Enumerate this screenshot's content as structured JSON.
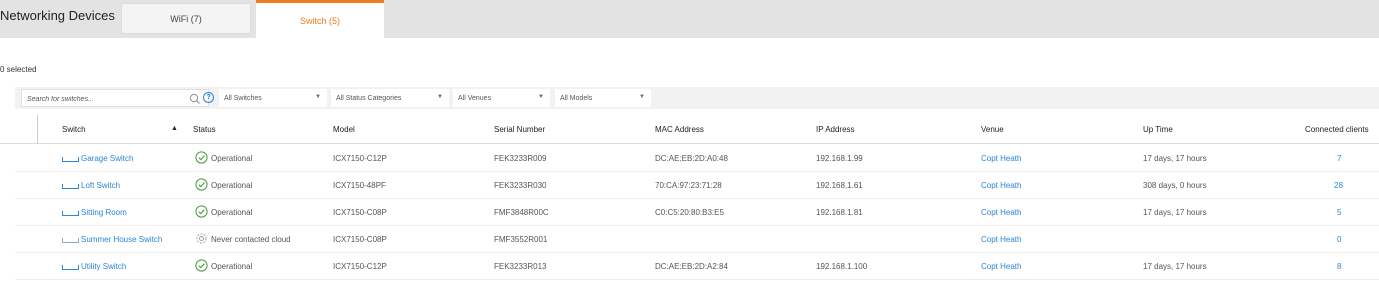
{
  "header": {
    "title": "Networking Devices",
    "tabs": [
      {
        "label": "WiFi (7)",
        "active": false
      },
      {
        "label": "Switch (5)",
        "active": true
      }
    ],
    "active_color": "#f07a1d"
  },
  "selection": {
    "count_label": "0 selected"
  },
  "filters": {
    "search_placeholder": "Search for switches...",
    "help_label": "?",
    "selects": [
      "All Switches",
      "All Status Categories",
      "All Venues",
      "All Models"
    ]
  },
  "table": {
    "columns": [
      "Switch",
      "Status",
      "Model",
      "Serial Number",
      "MAC Address",
      "IP Address",
      "Venue",
      "Up Time",
      "Connected clients"
    ],
    "sorted_column": "Switch",
    "rows": [
      {
        "name": "Garage Switch",
        "status": "Operational",
        "status_icon": "check-circle-icon",
        "model": "ICX7150-C12P",
        "serial": "FEK3233R009",
        "mac": "DC:AE:EB:2D:A0:48",
        "ip": "192.168.1.99",
        "venue": "Copt Heath",
        "uptime": "17 days, 17 hours",
        "clients": "7"
      },
      {
        "name": "Loft Switch",
        "status": "Operational",
        "status_icon": "check-circle-icon",
        "model": "ICX7150-48PF",
        "serial": "FEK3233R030",
        "mac": "70:CA:97:23:71:28",
        "ip": "192.168.1.61",
        "venue": "Copt Heath",
        "uptime": "308 days, 0 hours",
        "clients": "28"
      },
      {
        "name": "Sitting Room",
        "status": "Operational",
        "status_icon": "check-circle-icon",
        "model": "ICX7150-C08P",
        "serial": "FMF3848R00C",
        "mac": "C0:C5:20:80:B3:E5",
        "ip": "192.168.1.81",
        "venue": "Copt Heath",
        "uptime": "17 days, 17 hours",
        "clients": "5"
      },
      {
        "name": "Summer House Switch",
        "status": "Never contacted cloud",
        "status_icon": "gear-icon",
        "model": "ICX7150-C08P",
        "serial": "FMF3552R001",
        "mac": "",
        "ip": "",
        "venue": "Copt Heath",
        "uptime": "",
        "clients": "0"
      },
      {
        "name": "Utility Switch",
        "status": "Operational",
        "status_icon": "check-circle-icon",
        "model": "ICX7150-C12P",
        "serial": "FEK3233R013",
        "mac": "DC:AE:EB:2D:A2:84",
        "ip": "192.168.1.100",
        "venue": "Copt Heath",
        "uptime": "17 days, 17 hours",
        "clients": "8"
      }
    ]
  },
  "colors": {
    "link": "#2b86d3",
    "ok": "#4a9a3c",
    "muted": "#999999"
  }
}
